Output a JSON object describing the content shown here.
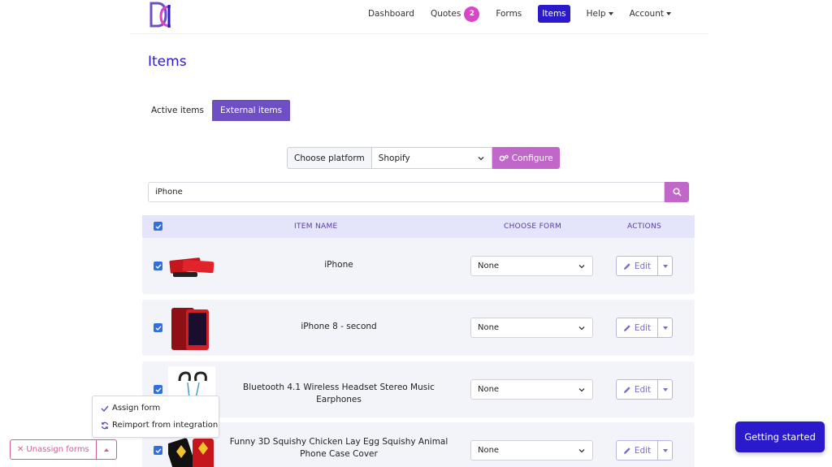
{
  "nav": {
    "links": [
      {
        "label": "Dashboard"
      },
      {
        "label": "Quotes",
        "badge": "2"
      },
      {
        "label": "Forms"
      },
      {
        "label": "Items",
        "active": true
      },
      {
        "label": "Help"
      },
      {
        "label": "Account"
      }
    ]
  },
  "page": {
    "title": "Items"
  },
  "tabs": [
    {
      "label": "Active items"
    },
    {
      "label": "External items",
      "active": true
    }
  ],
  "platform": {
    "label": "Choose platform",
    "selected": "Shopify",
    "configure_label": "Configure"
  },
  "search": {
    "value": "iPhone"
  },
  "table": {
    "headers": {
      "item_name": "ITEM NAME",
      "choose_form": "CHOOSE FORM",
      "actions": "ACTIONS"
    },
    "rows": [
      {
        "name": "iPhone",
        "form": "None",
        "edit_label": "Edit",
        "checked": true
      },
      {
        "name": "iPhone 8 - second",
        "form": "None",
        "edit_label": "Edit",
        "checked": true
      },
      {
        "name": "Bluetooth 4.1 Wireless Headset Stereo Music Earphones",
        "form": "None",
        "edit_label": "Edit",
        "checked": true
      },
      {
        "name": "Funny 3D Squishy Chicken Lay Egg Squishy Animal Phone Case Cover",
        "form": "None",
        "edit_label": "Edit",
        "checked": true
      }
    ]
  },
  "bulk": {
    "menu": {
      "assign_form": "Assign form",
      "reimport": "Reimport from integration"
    },
    "unassign_label": "Unassign forms"
  },
  "getting_started_label": "Getting started",
  "colors": {
    "primary": "#2b1acb",
    "accent": "#c167c9",
    "badge": "#d946c7",
    "tab_active": "#6e4fc4"
  }
}
